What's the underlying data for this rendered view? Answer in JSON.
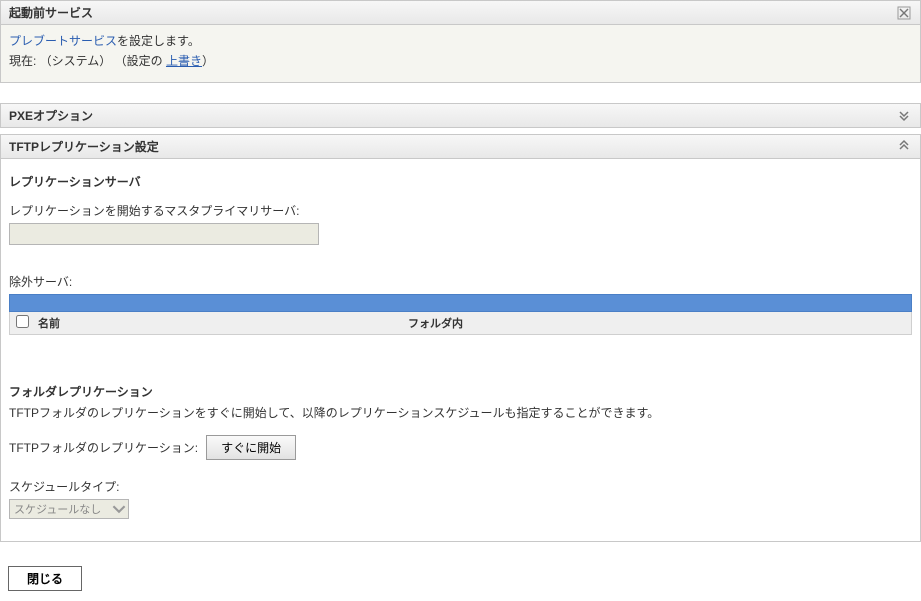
{
  "header": {
    "title": "起動前サービス",
    "preboot_link": "プレブートサービス",
    "preboot_suffix": "を設定します。",
    "current_line_prefix": "現在: （システム）  （設定の ",
    "overwrite_link": "上書き",
    "current_line_suffix": "）"
  },
  "pxe": {
    "title": "PXEオプション"
  },
  "tftp": {
    "title": "TFTPレプリケーション設定",
    "replication_server_heading": "レプリケーションサーバ",
    "master_label": "レプリケーションを開始するマスタプライマリサーバ:",
    "master_value": "",
    "excluded_label": "除外サーバ:",
    "table": {
      "col_name": "名前",
      "col_folder": "フォルダ内"
    },
    "folder_rep_heading": "フォルダレプリケーション",
    "folder_rep_desc": "TFTPフォルダのレプリケーションをすぐに開始して、以降のレプリケーションスケジュールも指定することができます。",
    "folder_rep_label": "TFTPフォルダのレプリケーション:",
    "start_now_btn": "すぐに開始",
    "schedule_type_label": "スケジュールタイプ:",
    "schedule_type_value": "スケジュールなし"
  },
  "footer": {
    "close": "閉じる"
  }
}
